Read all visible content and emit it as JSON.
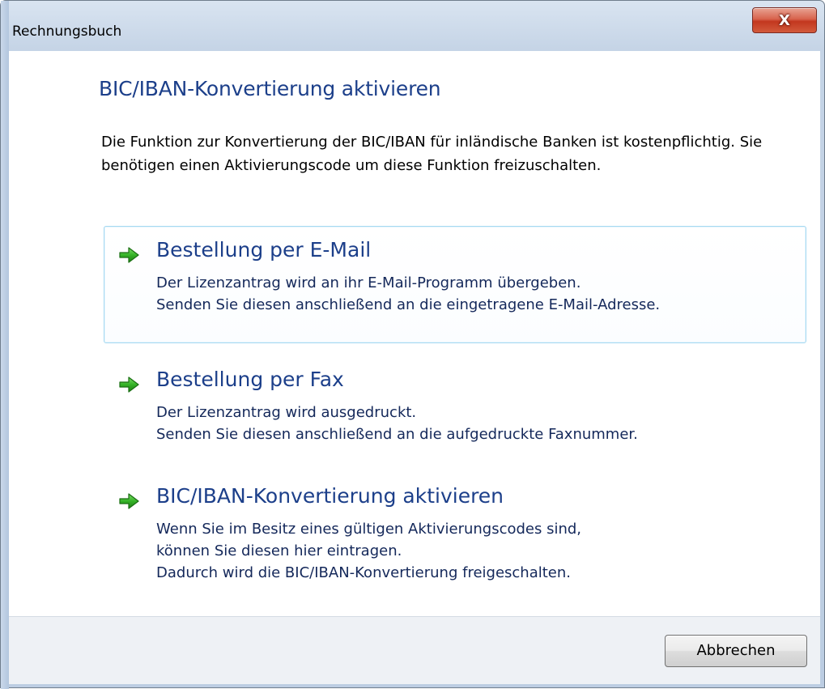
{
  "window": {
    "title": "Rechnungsbuch",
    "close_icon": "close-icon",
    "close_glyph": "X"
  },
  "main": {
    "instruction": "BIC/IBAN-Konvertierung aktivieren",
    "description": "Die Funktion zur Konvertierung der BIC/IBAN für inländische Banken ist kostenpflichtig. Sie benötigen einen Aktivierungscode um diese Funktion freizuschalten."
  },
  "links": [
    {
      "icon": "green-arrow-icon",
      "title": "Bestellung per E-Mail",
      "lines": [
        "Der Lizenzantrag wird an ihr E-Mail-Programm übergeben.",
        "Senden Sie diesen anschließend an die eingetragene E-Mail-Adresse."
      ]
    },
    {
      "icon": "green-arrow-icon",
      "title": "Bestellung per Fax",
      "lines": [
        "Der Lizenzantrag wird ausgedruckt.",
        "Senden Sie diesen anschließend an die aufgedruckte Faxnummer."
      ]
    },
    {
      "icon": "green-arrow-icon",
      "title": "BIC/IBAN-Konvertierung aktivieren",
      "lines": [
        "Wenn Sie im Besitz eines gültigen Aktivierungscodes sind,",
        "können Sie diesen hier eintragen.",
        "Dadurch wird die BIC/IBAN-Konvertierung freigeschalten."
      ]
    }
  ],
  "footer": {
    "cancel_label": "Abbrechen"
  },
  "colors": {
    "instruction_blue": "#1c3f8a",
    "link_desc_navy": "#14285a",
    "arrow_green": "#2ea043",
    "hover_border": "#a6d9f2",
    "close_red": "#c3371f",
    "footer_bg": "#eef1f5"
  }
}
